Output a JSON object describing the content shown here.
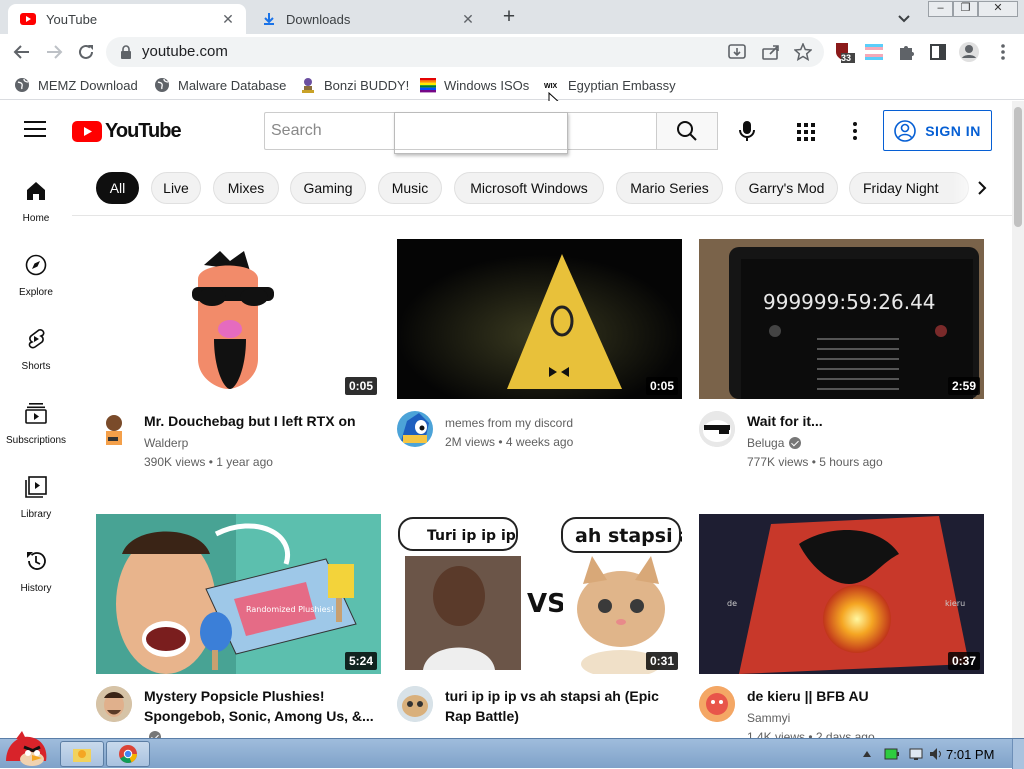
{
  "tabs": [
    {
      "title": "YouTube",
      "active": true,
      "icon": "youtube-favicon"
    },
    {
      "title": "Downloads",
      "active": false,
      "icon": "download-icon"
    }
  ],
  "toolbar": {
    "url": "youtube.com"
  },
  "extensions": {
    "badge_count": "33"
  },
  "bookmarks": [
    {
      "label": "MEMZ Download",
      "icon": "globe-icon"
    },
    {
      "label": "Malware Database",
      "icon": "globe-icon"
    },
    {
      "label": "Bonzi BUDDY!",
      "icon": "bonzi-icon"
    },
    {
      "label": "Windows ISOs",
      "icon": "windows-flag-icon"
    },
    {
      "label": "Egyptian Embassy",
      "icon": "wix-icon"
    }
  ],
  "masthead": {
    "logo_text": "YouTube",
    "search_placeholder": "Search",
    "sign_in": "SIGN IN"
  },
  "chips": [
    "All",
    "Live",
    "Mixes",
    "Gaming",
    "Music",
    "Microsoft Windows",
    "Mario Series",
    "Garry's Mod",
    "Friday Night"
  ],
  "guide": [
    {
      "label": "Home",
      "icon": "home-icon"
    },
    {
      "label": "Explore",
      "icon": "compass-icon"
    },
    {
      "label": "Shorts",
      "icon": "shorts-icon"
    },
    {
      "label": "Subscriptions",
      "icon": "subscriptions-icon"
    },
    {
      "label": "Library",
      "icon": "library-icon"
    },
    {
      "label": "History",
      "icon": "history-icon"
    }
  ],
  "videos": [
    {
      "title": "Mr. Douchebag but I left RTX on",
      "channel": "Walderp",
      "verified": false,
      "views": "390K views",
      "age": "1 year ago",
      "duration": "0:05"
    },
    {
      "title": "",
      "channel": "memes from my discord",
      "verified": false,
      "views": "2M views",
      "age": "4 weeks ago",
      "duration": "0:05"
    },
    {
      "title": "Wait for it...",
      "channel": "Beluga",
      "verified": true,
      "views": "777K views",
      "age": "5 hours ago",
      "duration": "2:59"
    },
    {
      "title": "Mystery Popsicle Plushies! Spongebob, Sonic, Among Us, &...",
      "channel": "",
      "verified": true,
      "views": "",
      "age": "",
      "duration": "5:24"
    },
    {
      "title": "turi ip ip ip vs ah stapsi ah (Epic Rap Battle)",
      "channel": "",
      "verified": false,
      "views": "",
      "age": "",
      "duration": "0:31"
    },
    {
      "title": "de kieru || BFB AU",
      "channel": "Sammyi",
      "verified": false,
      "views": "1.4K views",
      "age": "2 days ago",
      "duration": "0:37"
    }
  ],
  "thumb_text": {
    "timer": "999999:59:26.44",
    "bubble_left": "Turi ip ip ip",
    "bubble_right": "ah stapsi ah",
    "vs": "VS",
    "de": "de",
    "kieru": "kieru",
    "plush_sign": "Randomized Plushies!"
  },
  "taskbar": {
    "clock": "7:01 PM"
  },
  "colors": {
    "youtube_red": "#ff0000",
    "signin_blue": "#065fd4",
    "chip_selected": "#0f0f0f"
  }
}
